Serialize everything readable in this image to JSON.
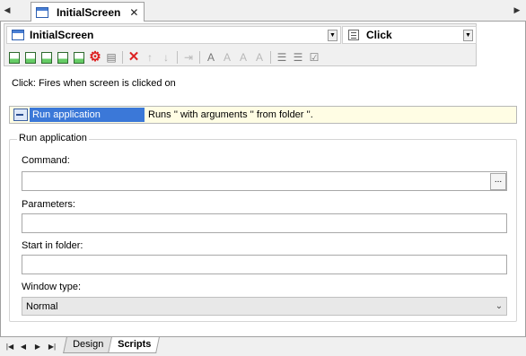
{
  "tab": {
    "label": "InitialScreen",
    "close": "✕"
  },
  "selectors": {
    "object": "InitialScreen",
    "event": "Click"
  },
  "toolbar": {
    "icons": [
      "add-action-icon",
      "insert-action-icon",
      "image-action-icon",
      "copy-action-icon",
      "import-icon",
      "export-icon",
      "print-icon",
      "delete-icon",
      "move-up-icon",
      "move-down-icon",
      "indent-icon",
      "find-icon",
      "find-next-icon",
      "replace-icon",
      "spell-icon",
      "properties-icon",
      "validate-icon",
      "checklist-icon"
    ]
  },
  "event_description": "Click: Fires when screen is clicked on",
  "action": {
    "name": "Run application",
    "description": "Runs '' with arguments '' from folder ''."
  },
  "form": {
    "group_title": "Run application",
    "command_label": "Command:",
    "command_value": "",
    "browse_label": "...",
    "parameters_label": "Parameters:",
    "parameters_value": "",
    "start_in_label": "Start in folder:",
    "start_in_value": "",
    "window_type_label": "Window type:",
    "window_type_value": "Normal"
  },
  "bottom_tabs": [
    {
      "label": "Design",
      "active": false
    },
    {
      "label": "Scripts",
      "active": true
    }
  ]
}
